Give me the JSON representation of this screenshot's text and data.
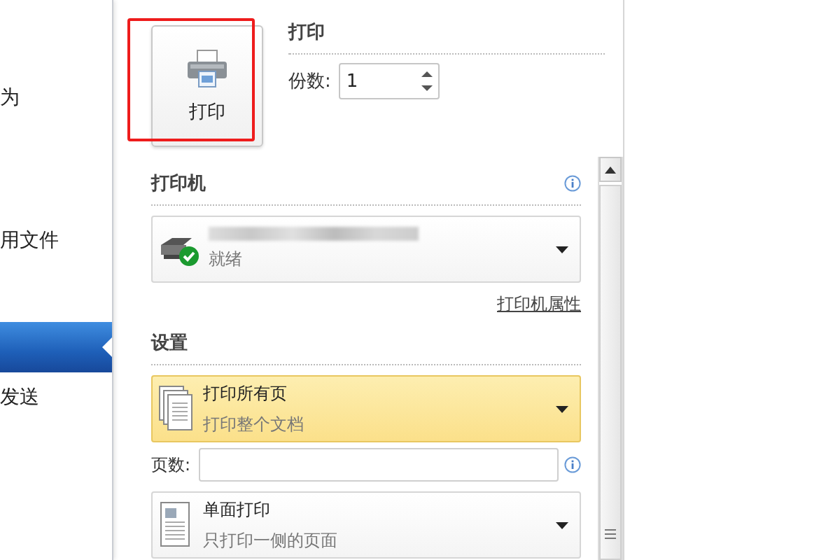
{
  "sidebar": {
    "items": [
      {
        "label": "为",
        "selected": false
      },
      {
        "label": "用文件",
        "selected": false
      },
      {
        "selected": true
      },
      {
        "label": "发送",
        "selected": false
      }
    ]
  },
  "print_button": {
    "label": "打印"
  },
  "print_section": {
    "title": "打印",
    "copies_label": "份数:",
    "copies_value": "1"
  },
  "printer": {
    "heading": "打印机",
    "status": "就绪",
    "properties_link": "打印机属性"
  },
  "settings": {
    "heading": "设置",
    "items": [
      {
        "kind": "dropdown",
        "title": "打印所有页",
        "subtitle": "打印整个文档",
        "selected": true
      },
      {
        "kind": "field",
        "label": "页数:"
      },
      {
        "kind": "dropdown",
        "title": "单面打印",
        "subtitle": "只打印一侧的页面",
        "selected": false
      }
    ]
  }
}
